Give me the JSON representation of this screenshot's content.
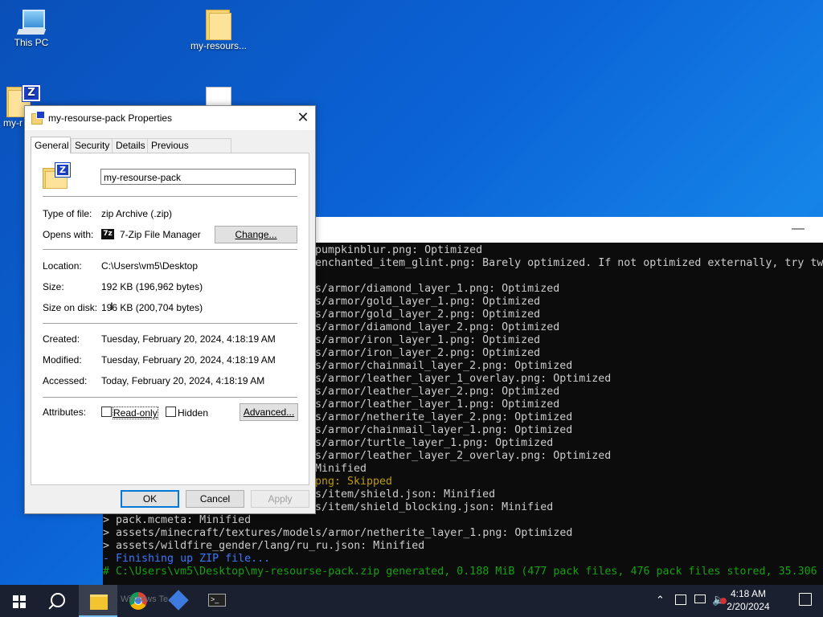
{
  "desktop": {
    "icons": [
      {
        "label": "This PC"
      },
      {
        "label": "my-resours..."
      },
      {
        "label": "my-r"
      },
      {
        "label": ""
      }
    ],
    "zip_badge_letter": "Z"
  },
  "terminal": {
    "minimize_glyph": "—",
    "lines": [
      {
        "text": "pumpkinblur.png: Optimized",
        "color": "white"
      },
      {
        "text": "enchanted_item_glint.png: Barely optimized. If not optimized externally, try tw",
        "color": "white"
      },
      {
        "text": "",
        "color": "white"
      },
      {
        "text": "s/armor/diamond_layer_1.png: Optimized",
        "color": "white"
      },
      {
        "text": "s/armor/gold_layer_1.png: Optimized",
        "color": "white"
      },
      {
        "text": "s/armor/gold_layer_2.png: Optimized",
        "color": "white"
      },
      {
        "text": "s/armor/diamond_layer_2.png: Optimized",
        "color": "white"
      },
      {
        "text": "s/armor/iron_layer_1.png: Optimized",
        "color": "white"
      },
      {
        "text": "s/armor/iron_layer_2.png: Optimized",
        "color": "white"
      },
      {
        "text": "s/armor/chainmail_layer_2.png: Optimized",
        "color": "white"
      },
      {
        "text": "s/armor/leather_layer_1_overlay.png: Optimized",
        "color": "white"
      },
      {
        "text": "s/armor/leather_layer_2.png: Optimized",
        "color": "white"
      },
      {
        "text": "s/armor/leather_layer_1.png: Optimized",
        "color": "white"
      },
      {
        "text": "s/armor/netherite_layer_2.png: Optimized",
        "color": "white"
      },
      {
        "text": "s/armor/chainmail_layer_1.png: Optimized",
        "color": "white"
      },
      {
        "text": "s/armor/turtle_layer_1.png: Optimized",
        "color": "white"
      },
      {
        "text": "s/armor/leather_layer_2_overlay.png: Optimized",
        "color": "white"
      },
      {
        "text": "Minified",
        "color": "white"
      },
      {
        "text": "png: Skipped",
        "color": "yellow"
      },
      {
        "text": "s/item/shield.json: Minified",
        "color": "white"
      },
      {
        "text": "s/item/shield_blocking.json: Minified",
        "color": "white"
      },
      {
        "text": "> pack.mcmeta: Minified",
        "color": "white"
      },
      {
        "text": "> assets/minecraft/textures/models/armor/netherite_layer_1.png: Optimized",
        "color": "white"
      },
      {
        "text": "> assets/wildfire_gender/lang/ru_ru.json: Minified",
        "color": "white"
      },
      {
        "text": "- Finishing up ZIP file...",
        "color": "blue"
      },
      {
        "text": "# C:\\Users\\vm5\\Desktop\\my-resourse-pack.zip generated, 0.188 MiB (477 pack files, 476 pack files stored, 35.306",
        "color": "green"
      }
    ],
    "colors": {
      "white": "#cccccc",
      "yellow": "#c19c00",
      "blue": "#3b78ff",
      "green": "#13a10e"
    }
  },
  "dialog": {
    "title": "my-resourse-pack Properties",
    "close_glyph": "✕",
    "tabs": [
      "General",
      "Security",
      "Details",
      "Previous Versions"
    ],
    "file_name": "my-resourse-pack",
    "type_label": "Type of file:",
    "type_value": "zip Archive (.zip)",
    "opens_label": "Opens with:",
    "opens_icon_text": "7z",
    "opens_value": "7-Zip File Manager",
    "change_button": "Change...",
    "location_label": "Location:",
    "location_value": "C:\\Users\\vm5\\Desktop",
    "size_label": "Size:",
    "size_value": "192 KB (196,962 bytes)",
    "size_disk_label": "Size on disk:",
    "size_disk_value": "196 KB (200,704 bytes)",
    "created_label": "Created:",
    "created_value": "Tuesday, February 20, 2024, 4:18:19 AM",
    "modified_label": "Modified:",
    "modified_value": "Tuesday, February 20, 2024, 4:18:19 AM",
    "accessed_label": "Accessed:",
    "accessed_value": "Today, February 20, 2024, 4:18:19 AM",
    "attributes_label": "Attributes:",
    "readonly_label": "Read-only",
    "hidden_label": "Hidden",
    "advanced_button": "Advanced...",
    "ok_button": "OK",
    "cancel_button": "Cancel",
    "apply_button": "Apply"
  },
  "taskbar": {
    "time": "4:18 AM",
    "date": "2/20/2024",
    "terminal_label": "Windows Te...",
    "accent": "#76b9ed"
  }
}
